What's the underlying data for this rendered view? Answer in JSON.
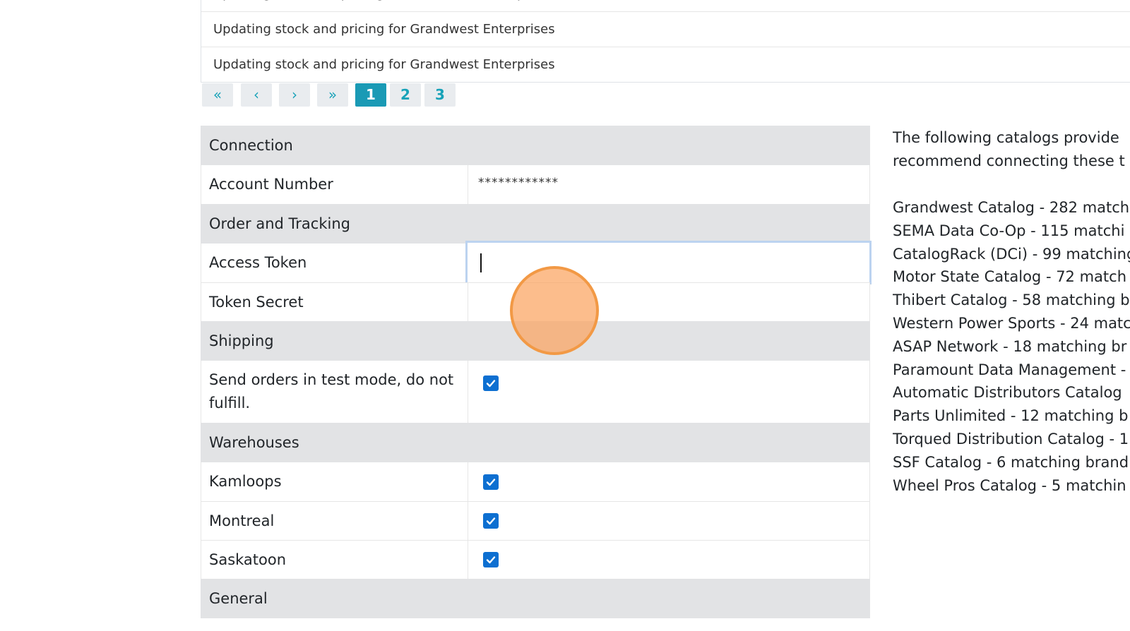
{
  "log": {
    "rows": [
      "Updating stock and pricing for Grandwest Enterprises",
      "Updating stock and pricing for Grandwest Enterprises",
      "Updating stock and pricing for Grandwest Enterprises"
    ]
  },
  "pagination": {
    "first": "«",
    "prev": "‹",
    "next": "›",
    "last": "»",
    "pages": [
      "1",
      "2",
      "3"
    ],
    "current": "1"
  },
  "settings": {
    "connection": {
      "title": "Connection",
      "account_number_label": "Account Number",
      "account_number_value": "************"
    },
    "order_tracking": {
      "title": "Order and Tracking",
      "access_token_label": "Access Token",
      "access_token_value": "",
      "token_secret_label": "Token Secret"
    },
    "shipping": {
      "title": "Shipping",
      "test_mode_label": "Send orders in test mode, do not fulfill.",
      "test_mode_checked": true
    },
    "warehouses": {
      "title": "Warehouses",
      "items": [
        {
          "label": "Kamloops",
          "checked": true
        },
        {
          "label": "Montreal",
          "checked": true
        },
        {
          "label": "Saskatoon",
          "checked": true
        }
      ]
    },
    "general": {
      "title": "General"
    }
  },
  "catalog_panel": {
    "intro_line1": "The following catalogs provide",
    "intro_line2": "recommend connecting these t",
    "items": [
      "Grandwest Catalog - 282 match",
      "SEMA Data Co-Op - 115 matchi",
      "CatalogRack (DCi) - 99 matching",
      "Motor State Catalog - 72 match",
      "Thibert Catalog - 58 matching b",
      "Western Power Sports - 24 matc",
      "ASAP Network - 18 matching br",
      "Paramount Data Management -",
      "Automatic Distributors Catalog",
      "Parts Unlimited - 12 matching b",
      "Torqued Distribution Catalog - 1",
      "SSF Catalog - 6 matching brand",
      "Wheel Pros Catalog - 5 matchin"
    ]
  },
  "colors": {
    "accent": "#1a9ab5",
    "checkbox": "#0d6fd1",
    "section_bg": "#e2e3e5",
    "click_indicator": "#f29945"
  }
}
